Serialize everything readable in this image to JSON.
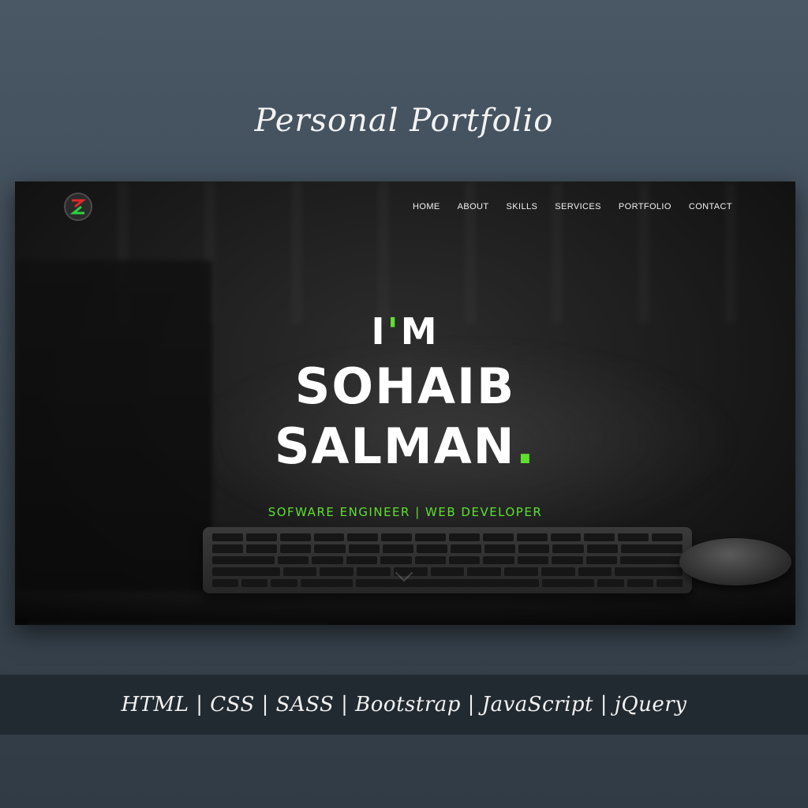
{
  "page": {
    "heading": "Personal Portfolio",
    "tech_stack": "HTML | CSS | SASS | Bootstrap | JavaScript | jQuery"
  },
  "site": {
    "logo_icon": "s-logo-icon",
    "nav": [
      {
        "label": "HOME"
      },
      {
        "label": "ABOUT"
      },
      {
        "label": "SKILLS"
      },
      {
        "label": "SERVICES"
      },
      {
        "label": "PORTFOLIO"
      },
      {
        "label": "CONTACT"
      }
    ],
    "hero": {
      "intro_before": "I",
      "intro_apostrophe": "'",
      "intro_after": "M",
      "first_name": "SOHAIB",
      "last_name": "SALMAN",
      "period": ".",
      "subtitle": "SOFWARE ENGINEER | WEB DEVELOPER"
    }
  },
  "colors": {
    "accent": "#5ee02f",
    "logo_red": "#e0282a",
    "logo_green": "#2bd144",
    "band": "#222a31"
  }
}
